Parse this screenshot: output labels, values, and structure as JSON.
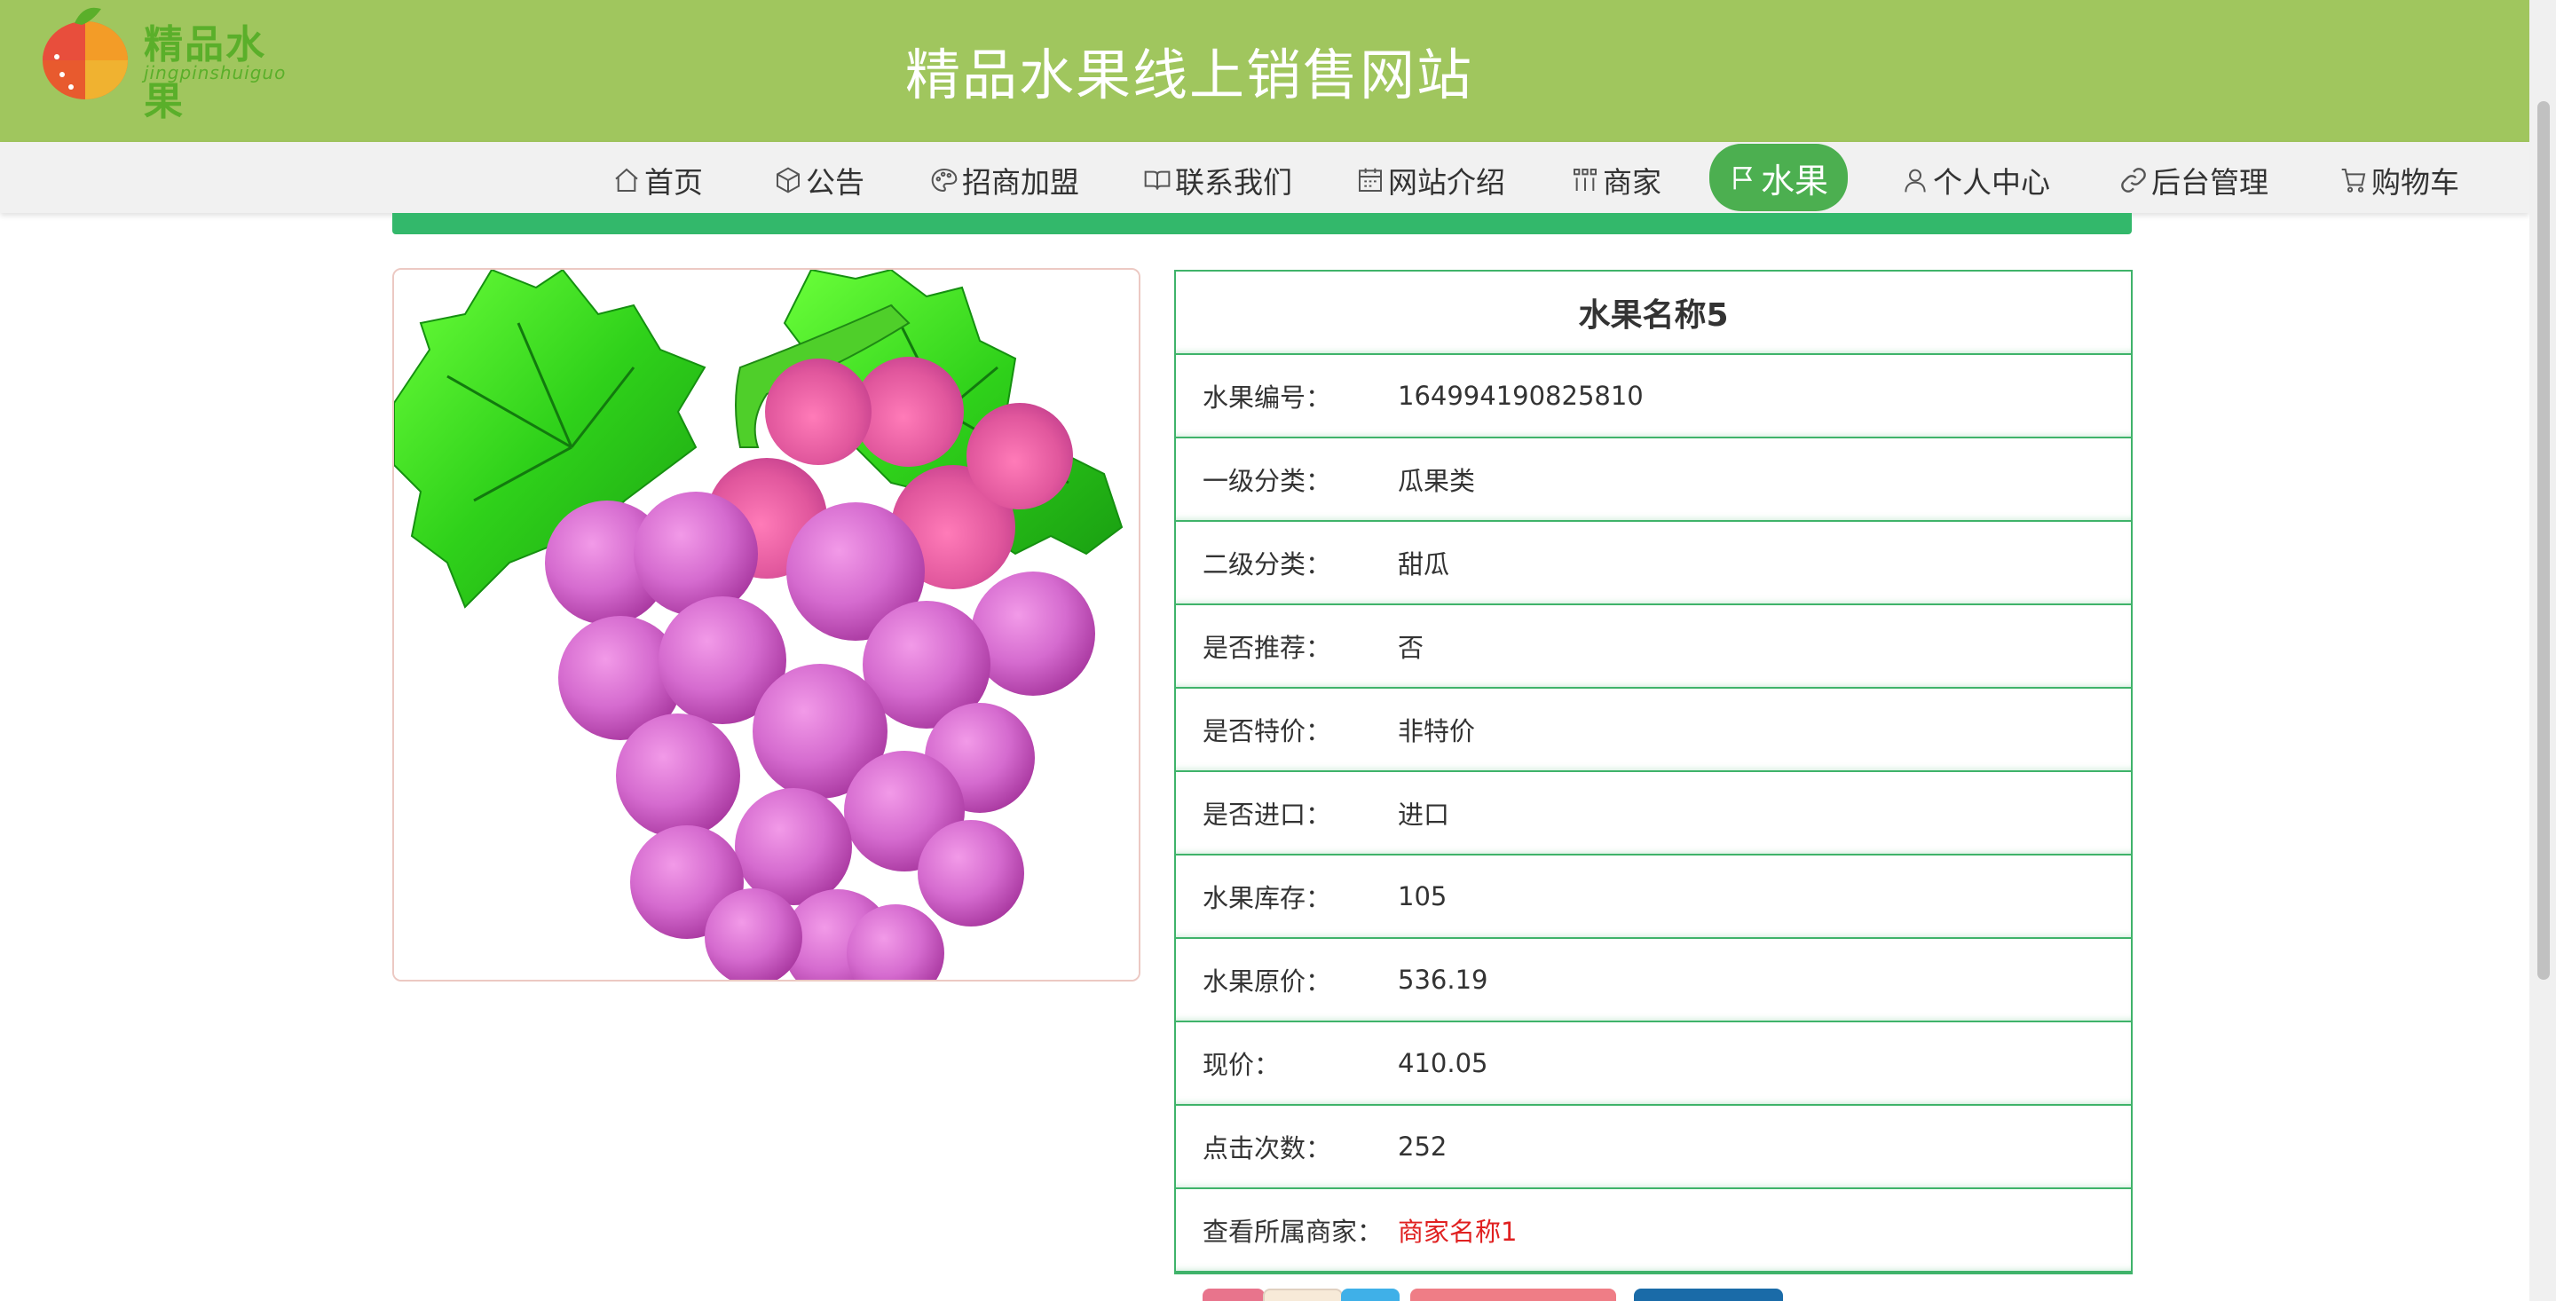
{
  "header": {
    "logo_text": "精品水果",
    "logo_sub": "jingpinshuiguo",
    "site_title": "精品水果线上销售网站"
  },
  "nav": {
    "items": [
      {
        "label": "首页",
        "icon": "home-icon"
      },
      {
        "label": "公告",
        "icon": "cube-icon"
      },
      {
        "label": "招商加盟",
        "icon": "palette-icon"
      },
      {
        "label": "联系我们",
        "icon": "book-icon"
      },
      {
        "label": "网站介绍",
        "icon": "calendar-icon"
      },
      {
        "label": "商家",
        "icon": "grid-icon"
      },
      {
        "label": "水果",
        "icon": "flag-icon",
        "active": true
      },
      {
        "label": "个人中心",
        "icon": "user-icon"
      },
      {
        "label": "后台管理",
        "icon": "link-icon"
      },
      {
        "label": "购物车",
        "icon": "cart-icon"
      }
    ],
    "active_color": "#4caf50"
  },
  "product": {
    "name": "水果名称5",
    "image_alt": "grape-bunch-image",
    "fields": [
      {
        "label": "水果编号：",
        "value": "164994190825810"
      },
      {
        "label": "一级分类：",
        "value": "瓜果类"
      },
      {
        "label": "二级分类：",
        "value": "甜瓜"
      },
      {
        "label": "是否推荐：",
        "value": "否"
      },
      {
        "label": "是否特价：",
        "value": "非特价"
      },
      {
        "label": "是否进口：",
        "value": "进口"
      },
      {
        "label": "水果库存：",
        "value": "105"
      },
      {
        "label": "水果原价：",
        "value": "536.19"
      },
      {
        "label": "现价：",
        "value": "410.05"
      },
      {
        "label": "点击次数：",
        "value": "252"
      },
      {
        "label": "查看所属商家：",
        "value": "商家名称1",
        "link": true
      }
    ]
  },
  "colors": {
    "header_bg": "#a0c65e",
    "accent_green": "#33b86b",
    "table_border": "#3fb36a",
    "link_red": "#e02020"
  }
}
